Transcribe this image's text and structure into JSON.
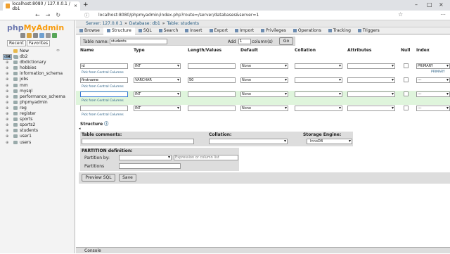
{
  "browser": {
    "tab_title": "localhost:8080 / 127.0.0.1 / db1",
    "url": "localhost:8080/phpmyadmin/index.php?route=/server/databases&server=1"
  },
  "sidebar": {
    "logo_a": "php",
    "logo_b": "MyAdmin",
    "recent": "Recent",
    "favorites": "Favorites",
    "items": [
      "New",
      "db1",
      "db2",
      "dbdictionary",
      "hobbies",
      "information_schema",
      "jobs",
      "mm",
      "mysql",
      "performance_schema",
      "phpmyadmin",
      "reg",
      "register",
      "sports",
      "sports2",
      "students",
      "user1",
      "users"
    ]
  },
  "breadcrumb": {
    "server": "Server: 127.0.0.1",
    "database": "Database: db1",
    "table": "Table: students"
  },
  "menu": [
    "Browse",
    "Structure",
    "SQL",
    "Search",
    "Insert",
    "Export",
    "Import",
    "Privileges",
    "Operations",
    "Tracking",
    "Triggers"
  ],
  "form": {
    "table_name_label": "Table name:",
    "table_name_value": "students",
    "add_label": "Add",
    "add_value": "1",
    "columns_label": "column(s)",
    "go": "Go"
  },
  "headers": [
    "Name",
    "Type",
    "Length/Values",
    "Default",
    "Collation",
    "Attributes",
    "Null",
    "Index"
  ],
  "pick_link": "Pick from Central Columns",
  "rows": [
    {
      "name": "id",
      "type": "INT",
      "length": "",
      "default": "None",
      "index": "PRIMARY",
      "index_sub": "PRIMARY"
    },
    {
      "name": "firstname",
      "type": "VARCHAR",
      "length": "50",
      "default": "None",
      "index": "---",
      "index_sub": ""
    },
    {
      "name": "",
      "type": "INT",
      "length": "",
      "default": "None",
      "index": "---",
      "index_sub": ""
    },
    {
      "name": "",
      "type": "INT",
      "length": "",
      "default": "None",
      "index": "---",
      "index_sub": ""
    }
  ],
  "structure_label": "Structure",
  "table_comments_label": "Table comments:",
  "collation_label": "Collation:",
  "storage_label": "Storage Engine:",
  "storage_value": "InnoDB",
  "partition_def_label": "PARTITION definition:",
  "partition_by_label": "Partition by:",
  "partition_expr_placeholder": "Expression or column list",
  "partitions_label": "Partitions",
  "preview_sql": "Preview SQL",
  "save": "Save",
  "console": "Console"
}
